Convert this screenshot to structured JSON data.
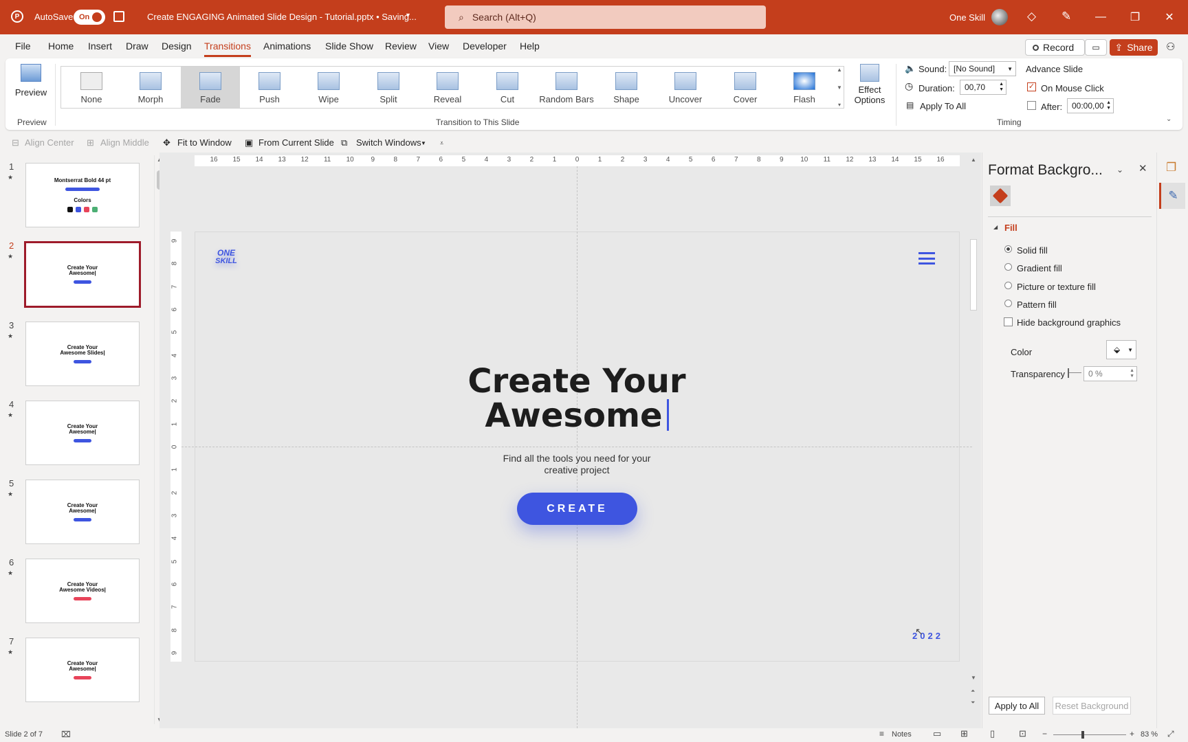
{
  "titlebar": {
    "autosave_label": "AutoSave",
    "autosave_state": "On",
    "doc_title": "Create ENGAGING Animated Slide Design - Tutorial.pptx • Saving...",
    "search_placeholder": "Search (Alt+Q)",
    "user_name": "One Skill",
    "minimize": "—",
    "restore": "❐",
    "close": "✕"
  },
  "menu": {
    "tabs": [
      "File",
      "Home",
      "Insert",
      "Draw",
      "Design",
      "Transitions",
      "Animations",
      "Slide Show",
      "Review",
      "View",
      "Developer",
      "Help"
    ],
    "record": "Record",
    "share": "Share"
  },
  "ribbon": {
    "preview": "Preview",
    "preview_group": "Preview",
    "transitions": [
      "None",
      "Morph",
      "Fade",
      "Push",
      "Wipe",
      "Split",
      "Reveal",
      "Cut",
      "Random Bars",
      "Shape",
      "Uncover",
      "Cover",
      "Flash"
    ],
    "selected_transition": "Fade",
    "effect_options_1": "Effect",
    "effect_options_2": "Options",
    "group_transition": "Transition to This Slide",
    "sound_label": "Sound:",
    "sound_value": "[No Sound]",
    "duration_label": "Duration:",
    "duration_value": "00,70",
    "apply_all": "Apply To All",
    "advance_label": "Advance Slide",
    "on_click": "On Mouse Click",
    "on_click_checked": true,
    "after_label": "After:",
    "after_value": "00:00,00",
    "timing_group": "Timing"
  },
  "quickbar": {
    "align_center": "Align Center",
    "align_middle": "Align Middle",
    "fit_window": "Fit to Window",
    "from_current": "From Current Slide",
    "switch_windows": "Switch Windows"
  },
  "ruler": {
    "h_ticks": [
      "16",
      "15",
      "14",
      "13",
      "12",
      "11",
      "10",
      "9",
      "8",
      "7",
      "6",
      "5",
      "4",
      "3",
      "2",
      "1",
      "0",
      "1",
      "2",
      "3",
      "4",
      "5",
      "6",
      "7",
      "8",
      "9",
      "10",
      "11",
      "12",
      "13",
      "14",
      "15",
      "16"
    ],
    "v_ticks": [
      "9",
      "8",
      "7",
      "6",
      "5",
      "4",
      "3",
      "2",
      "1",
      "0",
      "1",
      "2",
      "3",
      "4",
      "5",
      "6",
      "7",
      "8",
      "9"
    ]
  },
  "thumbnails": [
    {
      "num": "1",
      "title": "Montserrat Bold 44 pt",
      "sub": "Colors"
    },
    {
      "num": "2",
      "title": "Create Your Awesome|"
    },
    {
      "num": "3",
      "title": "Create Your Awesome Slides|"
    },
    {
      "num": "4",
      "title": "Create Your Awesome|"
    },
    {
      "num": "5",
      "title": "Create Your Awesome|"
    },
    {
      "num": "6",
      "title": "Create Your Awesome Videos|"
    },
    {
      "num": "7",
      "title": "Create Your Awesome|"
    }
  ],
  "slide": {
    "logo_line1": "ONE",
    "logo_line2": "SKILL",
    "title_line1": "Create Your",
    "title_line2": "Awesome",
    "subtitle_line1": "Find all the tools you need for your",
    "subtitle_line2": "creative project",
    "button": "CREATE",
    "year": "2022",
    "accent": "#3e55e0"
  },
  "format_pane": {
    "title": "Format Backgro...",
    "section": "Fill",
    "options": [
      "Solid fill",
      "Gradient fill",
      "Picture or texture fill",
      "Pattern fill"
    ],
    "selected": "Solid fill",
    "hide_graphics": "Hide background graphics",
    "color_label": "Color",
    "transparency_label": "Transparency",
    "transparency_value": "0 %",
    "apply_all": "Apply to All",
    "reset": "Reset Background"
  },
  "status": {
    "slide_info": "Slide 2 of 7",
    "notes": "Notes",
    "zoom": "83 %"
  },
  "colors": {
    "brand": "#c43e1c",
    "accent": "#3e55e0"
  }
}
